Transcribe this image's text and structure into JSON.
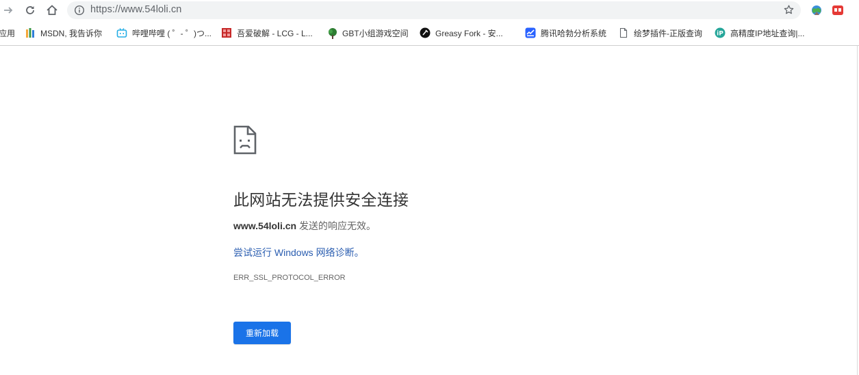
{
  "toolbar": {
    "url": "https://www.54loli.cn",
    "icons": [
      "forward-icon",
      "reload-icon",
      "home-icon",
      "info-icon",
      "star-icon",
      "extension-globe-icon",
      "extension-red-icon"
    ]
  },
  "bookmarks": [
    {
      "label": "应用",
      "icon": "apps-icon"
    },
    {
      "label": "MSDN, 我告诉你",
      "icon": "msdn-icon"
    },
    {
      "label": "哔哩哔哩 ( ゜- ゜)つ...",
      "icon": "bilibili-icon"
    },
    {
      "label": "吾爱破解 - LCG - L...",
      "icon": "52pojie-icon"
    },
    {
      "label": "GBT小组游戏空间",
      "icon": "tree-icon"
    },
    {
      "label": "Greasy Fork - 安...",
      "icon": "greasyfork-icon"
    },
    {
      "label": "腾讯哈勃分析系统",
      "icon": "habo-icon"
    },
    {
      "label": "绘梦插件-正版查询",
      "icon": "page-icon"
    },
    {
      "label": "高精度IP地址查询|...",
      "icon": "ip-icon"
    }
  ],
  "error": {
    "icon": "broken-page-icon",
    "title": "此网站无法提供安全连接",
    "host": "www.54loli.cn",
    "desc_suffix": " 发送的响应无效。",
    "diagnose_link": "尝试运行 Windows 网络诊断",
    "diagnose_suffix": "。",
    "code": "ERR_SSL_PROTOCOL_ERROR",
    "reload_label": "重新加载"
  },
  "colors": {
    "accent": "#1a73e8",
    "link": "#2a5db0",
    "omnibox_bg": "#f1f3f4"
  }
}
